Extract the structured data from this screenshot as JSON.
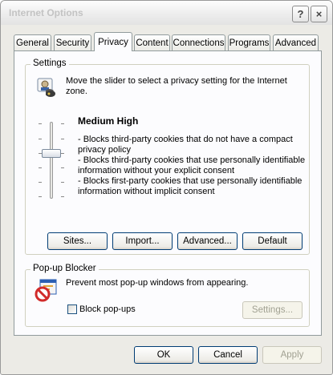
{
  "window": {
    "title": "Internet Options",
    "help_glyph": "?",
    "close_glyph": "×"
  },
  "tabs": [
    {
      "label": "General"
    },
    {
      "label": "Security"
    },
    {
      "label": "Privacy"
    },
    {
      "label": "Content"
    },
    {
      "label": "Connections"
    },
    {
      "label": "Programs"
    },
    {
      "label": "Advanced"
    }
  ],
  "active_tab": "Privacy",
  "settings": {
    "group_label": "Settings",
    "intro": [
      "Move the slider to select a privacy setting for the Internet",
      "zone."
    ],
    "level_title": "Medium High",
    "slider_level": "4 of 6",
    "description": [
      "- Blocks third-party cookies that do not have a compact",
      "privacy policy",
      "- Blocks third-party cookies that use personally identifiable",
      "information without your explicit consent",
      "- Blocks first-party cookies that use personally identifiable",
      "information without implicit consent"
    ],
    "buttons": {
      "sites": "Sites...",
      "import": "Import...",
      "advanced": "Advanced...",
      "default": "Default"
    }
  },
  "popup_blocker": {
    "group_label": "Pop-up Blocker",
    "text": "Prevent most pop-up windows from appearing.",
    "checkbox_label": "Block pop-ups",
    "checkbox_checked": false,
    "settings_button": "Settings..."
  },
  "footer": {
    "ok": "OK",
    "cancel": "Cancel",
    "apply": "Apply"
  }
}
